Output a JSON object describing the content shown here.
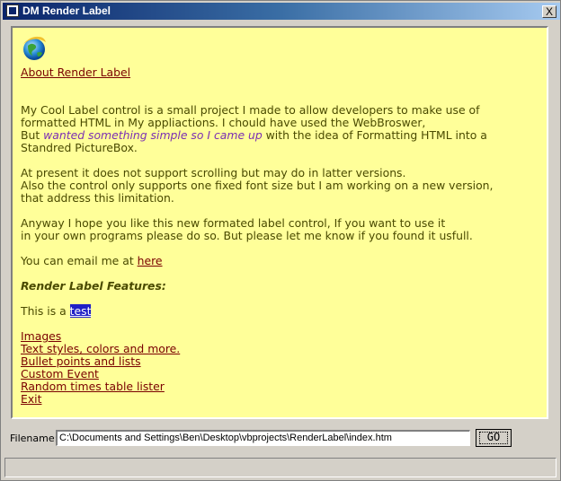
{
  "window": {
    "title": "DM Render Label",
    "close_label": "X"
  },
  "viewer": {
    "about_link": "About Render Label",
    "para1": [
      "My Cool Label control is a small project I made to allow developers to make use of",
      "formatted HTML in My appliactions. I chould have used the WebBroswer,"
    ],
    "para1_line3_pre": "But ",
    "para1_line3_purple": "wanted something simple so I came up",
    "para1_line3_post": " with the idea of Formatting HTML into a",
    "para1_line4": "Standred PictureBox.",
    "para2": [
      "At present it does not support scrolling but may do in latter versions.",
      "Also the control only supports one fixed font size but I am working on a new version,",
      "that address this limitation."
    ],
    "para3": [
      "Anyway I hope you like this new formated label control, If you want to use it",
      "in your own programs please do so. But please let me know if you found it usfull."
    ],
    "email_prefix": "You can email me at ",
    "email_link": "here",
    "features_heading": "Render Label Features:",
    "test_prefix": "This is a ",
    "test_highlight": "test",
    "links": [
      "Images",
      "Text styles, colors and more.",
      "Bullet points and lists",
      "Custom Event",
      "Random times table lister",
      "Exit"
    ]
  },
  "filename": {
    "label": "Filename:",
    "value": "C:\\Documents and Settings\\Ben\\Desktop\\vbprojects\\RenderLabel\\index.htm",
    "go_label": "GO"
  },
  "status": {
    "text": ""
  },
  "icons": {
    "title": "app-icon",
    "globe": "globe-icon"
  }
}
